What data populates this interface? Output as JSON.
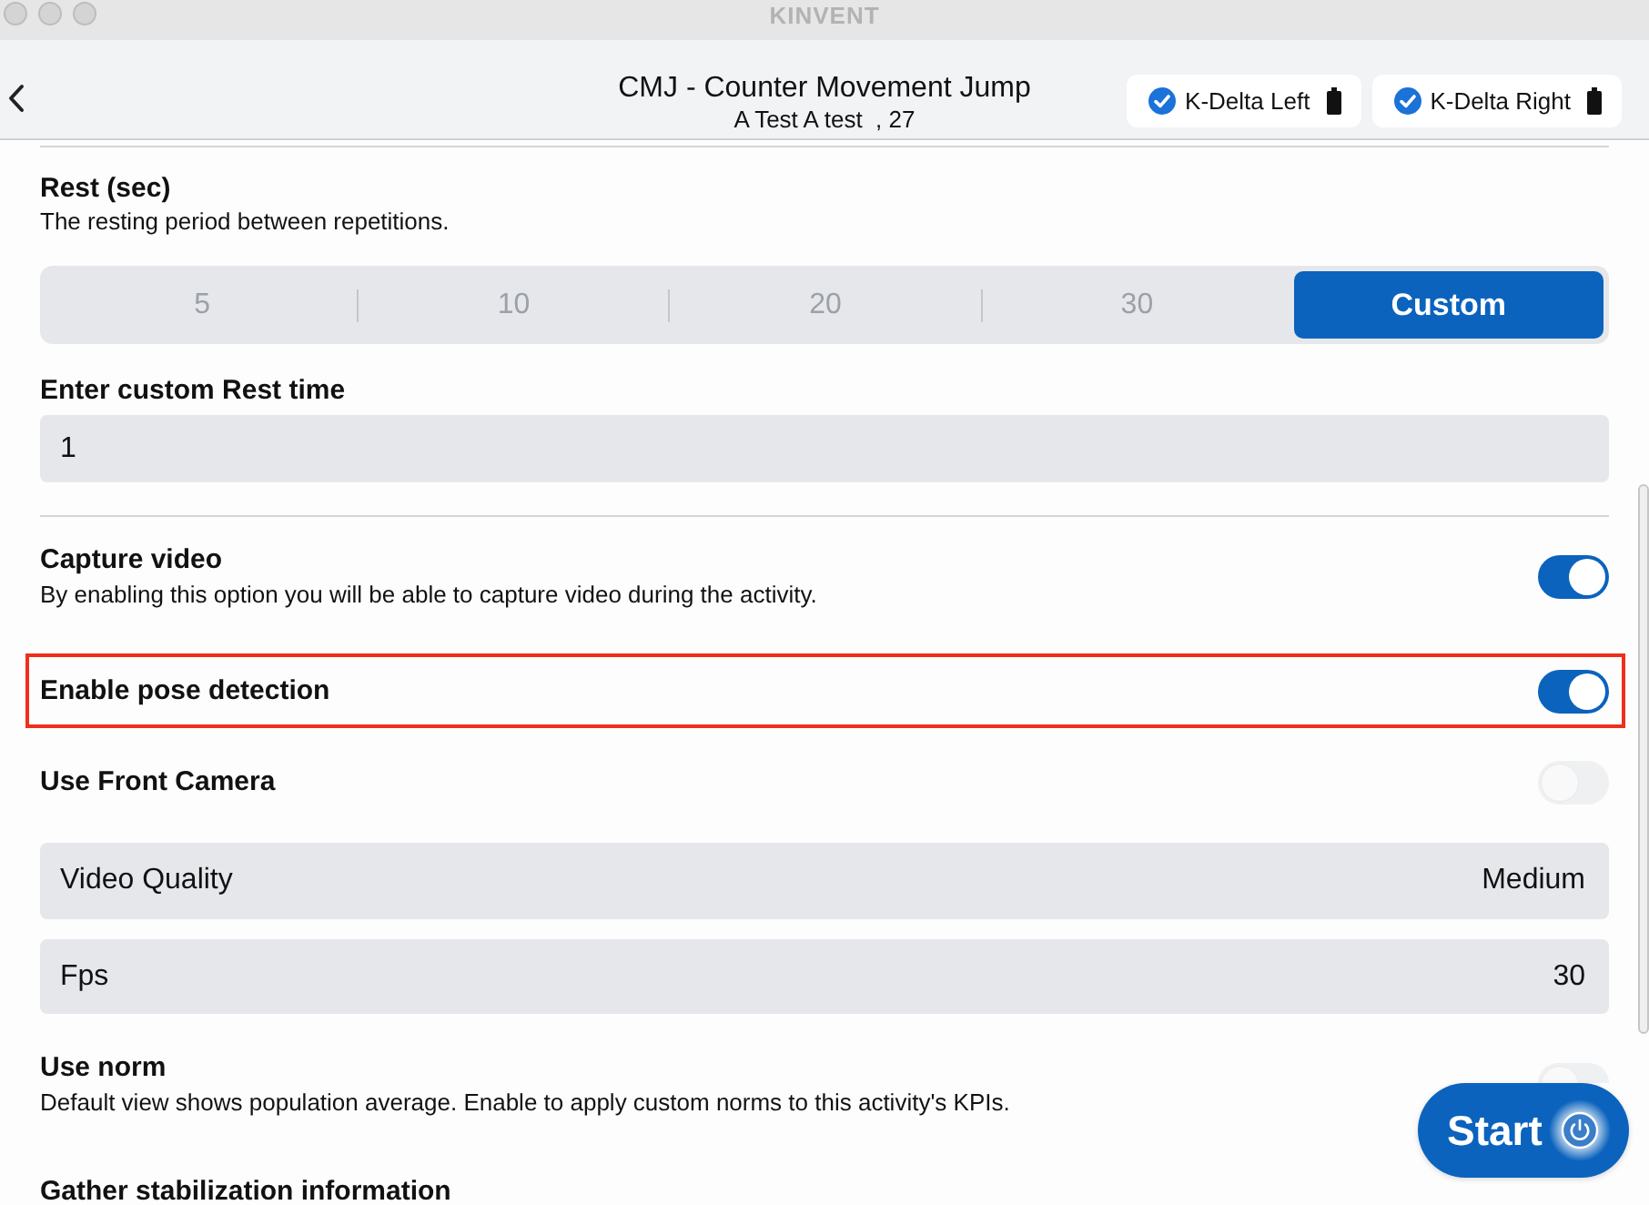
{
  "window": {
    "title": "KINVENT"
  },
  "header": {
    "title": "CMJ - Counter Movement Jump",
    "subtitle": "A Test A test  , 27",
    "devices": [
      {
        "name": "K-Delta Left",
        "connected": true
      },
      {
        "name": "K-Delta Right",
        "connected": true
      }
    ]
  },
  "rest": {
    "label": "Rest (sec)",
    "description": "The resting period between repetitions.",
    "options": [
      {
        "label": "5",
        "selected": false
      },
      {
        "label": "10",
        "selected": false
      },
      {
        "label": "20",
        "selected": false
      },
      {
        "label": "30",
        "selected": false
      },
      {
        "label": "Custom",
        "selected": true
      }
    ]
  },
  "custom_rest": {
    "label": "Enter custom Rest time",
    "value": "1"
  },
  "settings": [
    {
      "kind": "toggle",
      "label": "Capture video",
      "description": "By enabling this option you will be able to capture video during the activity.",
      "on": true,
      "highlighted": false
    },
    {
      "kind": "toggle",
      "label": "Enable pose detection",
      "on": true,
      "highlighted": true
    },
    {
      "kind": "toggle",
      "label": "Use Front Camera",
      "on": false,
      "highlighted": false
    },
    {
      "kind": "select",
      "label": "Video Quality",
      "value": "Medium"
    },
    {
      "kind": "select",
      "label": "Fps",
      "value": "30"
    },
    {
      "kind": "toggle",
      "label": "Use norm",
      "description": "Default view shows population average. Enable to apply custom norms to this activity's KPIs.",
      "on": false,
      "highlighted": false
    },
    {
      "kind": "heading",
      "label": "Gather stabilization information"
    }
  ],
  "start_button": {
    "label": "Start"
  }
}
